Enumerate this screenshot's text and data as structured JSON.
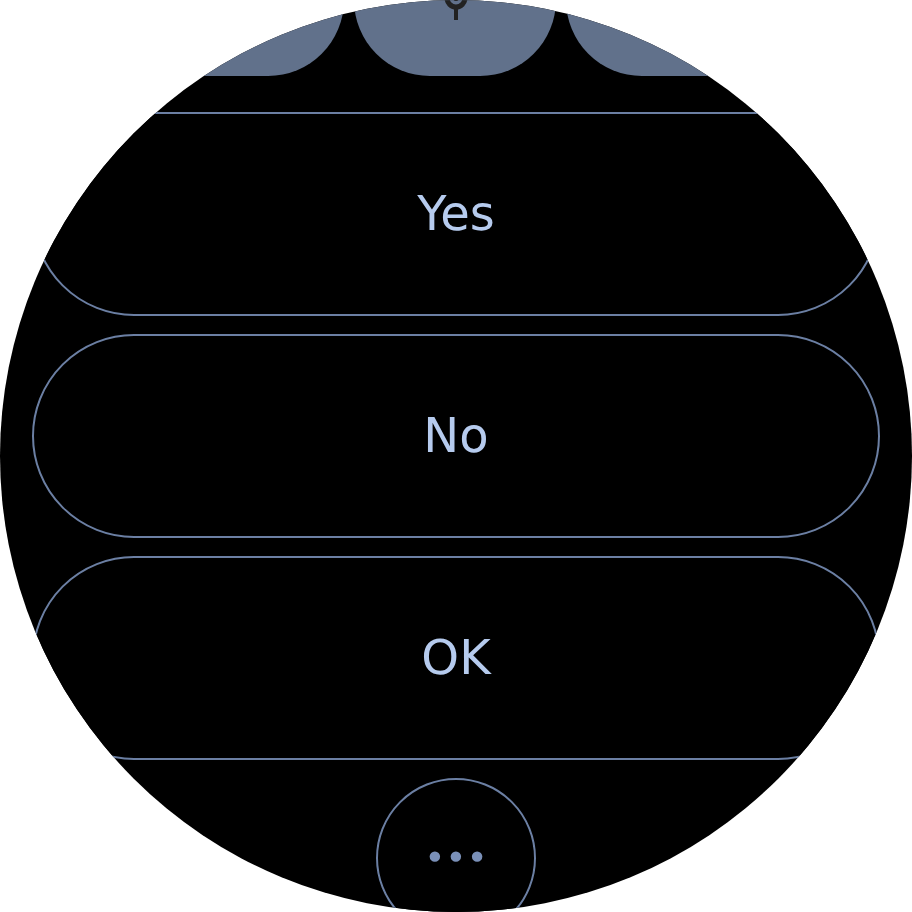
{
  "buttons": [
    {
      "label": "Yes"
    },
    {
      "label": "No"
    },
    {
      "label": "OK"
    }
  ],
  "more_button": {
    "label": "•••"
  }
}
